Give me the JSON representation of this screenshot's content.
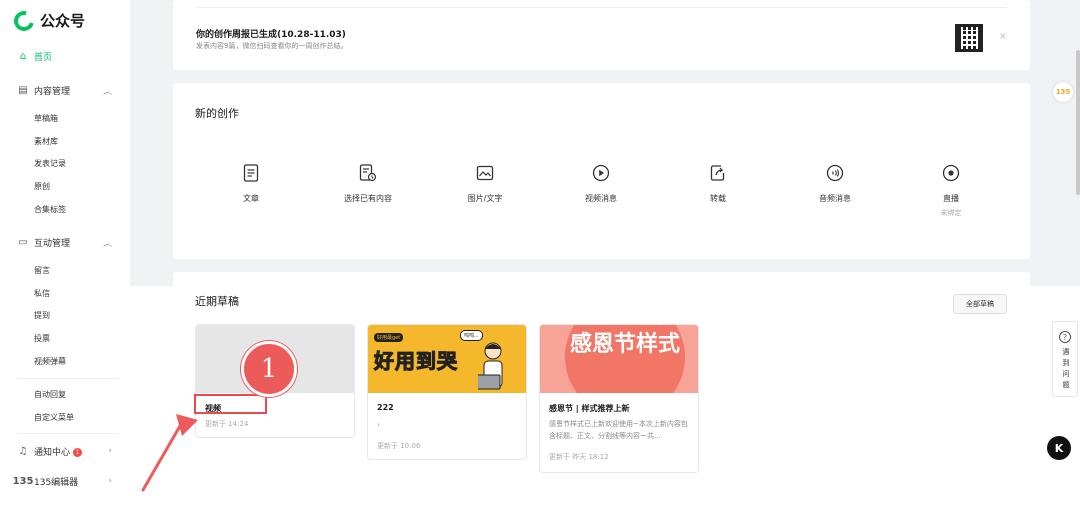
{
  "app": {
    "logo_text": "公众号"
  },
  "sidebar": {
    "home": "首页",
    "content_mgmt": "内容管理",
    "content_items": [
      "草稿箱",
      "素材库",
      "发表记录",
      "原创",
      "合集标签"
    ],
    "interact_mgmt": "互动管理",
    "interact_items": [
      "留言",
      "私信",
      "提到",
      "投票",
      "视频弹幕"
    ],
    "other_items": [
      "自动回复",
      "自定义菜单"
    ],
    "notify": "通知中心",
    "notify_badge": "1",
    "editor_icon": "135",
    "editor": "135编辑器"
  },
  "weekly": {
    "title": "你的创作周报已生成(10.28-11.03)",
    "subtitle": "发表内容9篇，微信扫码查看你的一周创作总结。",
    "close": "×"
  },
  "create": {
    "title": "新的创作",
    "items": [
      {
        "label": "文章",
        "icon": "article-icon"
      },
      {
        "label": "选择已有内容",
        "icon": "select-content-icon"
      },
      {
        "label": "图片/文字",
        "icon": "image-text-icon"
      },
      {
        "label": "视频消息",
        "icon": "video-play-icon"
      },
      {
        "label": "转载",
        "icon": "repost-icon"
      },
      {
        "label": "音频消息",
        "icon": "audio-icon"
      },
      {
        "label": "直播",
        "sub": "未绑定",
        "icon": "live-icon"
      }
    ]
  },
  "drafts": {
    "title": "近期草稿",
    "all_button": "全部草稿",
    "cards": [
      {
        "title": "视频",
        "time": "更新于 14:24"
      },
      {
        "title": "222",
        "desc": "，",
        "time": "更新于 10:06",
        "thumb_text": "好用到哭",
        "thumb_tag1": "好用最get",
        "thumb_tag2": "呜呜..."
      },
      {
        "title": "感恩节 | 样式推荐上新",
        "desc": "感恩节样式已上新欢迎使用~本次上新内容包含标题、正文、分割线等内容一共...",
        "time": "更新于 昨天 18:12",
        "thumb_text": "感恩节样式"
      }
    ]
  },
  "annotation": {
    "number": "1"
  },
  "floating": {
    "r135": "135",
    "problem_text": "遇到问题",
    "k_label": "K"
  },
  "colors": {
    "accent": "#07c160",
    "annotation": "#ec4b4b"
  }
}
